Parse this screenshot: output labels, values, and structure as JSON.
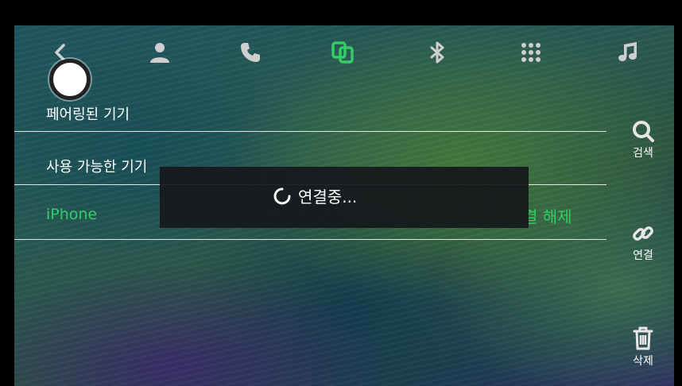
{
  "colors": {
    "accent_green": "#33cc66",
    "text": "#ffffff",
    "toast_bg": "#16181c"
  },
  "top_nav": {
    "icons": [
      "back-icon",
      "contacts-icon",
      "phone-icon",
      "phone-link-icon",
      "bluetooth-icon",
      "apps-grid-icon",
      "music-icon"
    ],
    "active": "phone-link-icon"
  },
  "device_list": {
    "paired_header": "페어링된 기기",
    "available_header": "사용 가능한 기기",
    "device_name": "iPhone",
    "disconnect_label": "결 해제"
  },
  "sidebar": {
    "search_label": "검색",
    "connect_label": "연결",
    "delete_label": "삭제"
  },
  "toast": {
    "text": "연결중...",
    "icon": "spinner-icon"
  }
}
